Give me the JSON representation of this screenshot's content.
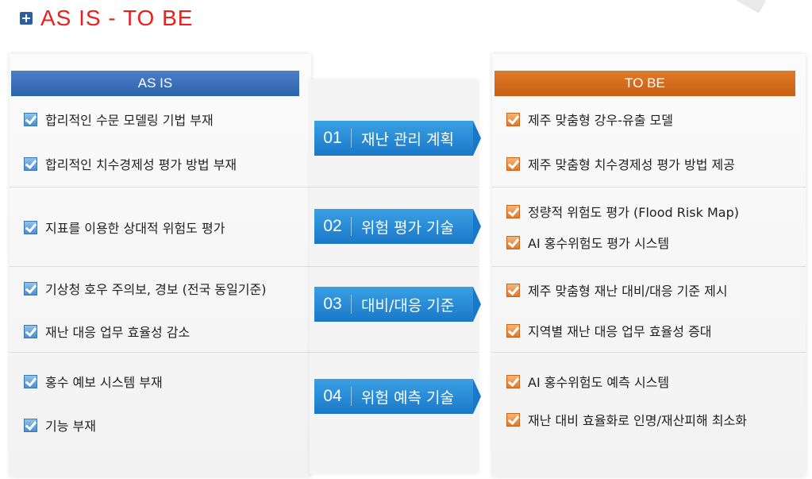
{
  "title": "AS IS  - TO BE",
  "asis": {
    "header": "AS  IS",
    "items": [
      "합리적인 수문 모델링 기법  부재",
      "합리적인 치수경제성 평가 방법 부재",
      "지표를 이용한 상대적 위험도 평가",
      "기상청 호우 주의보, 경보 (전국 동일기준)",
      "재난 대응 업무 효율성 감소",
      "홍수 예보 시스템 부재",
      "기능 부재"
    ]
  },
  "center": {
    "steps": [
      {
        "num": "01",
        "label": "재난 관리 계획"
      },
      {
        "num": "02",
        "label": "위험 평가 기술"
      },
      {
        "num": "03",
        "label": "대비/대응 기준"
      },
      {
        "num": "04",
        "label": "위험 예측 기술"
      }
    ]
  },
  "tobe": {
    "header": "TO BE",
    "items": [
      "제주 맞춤형 강우-유출 모델",
      "제주 맞춤형 치수경제성 평가 방법 제공",
      "정량적 위험도 평가 (Flood Risk Map)",
      "AI 홍수위험도 평가 시스템",
      "제주 맞춤형 재난 대비/대응 기준 제시",
      "지역별 재난 대응 업무 효율성 증대",
      "AI 홍수위험도 예측 시스템",
      "재난 대비 효율화로 인명/재산피해 최소화"
    ]
  },
  "colors": {
    "title": "#e8211f",
    "asis": "#2d62ae",
    "tobe": "#c85f14",
    "pill": "#1a78c8"
  }
}
